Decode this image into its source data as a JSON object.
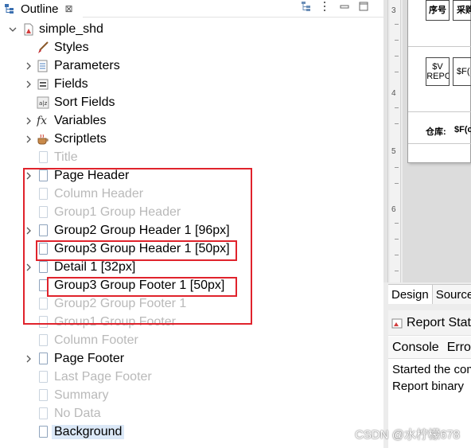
{
  "outline": {
    "tab_label": "Outline",
    "tab_close": "⊠",
    "root": {
      "label": "simple_shd",
      "twisty": "⌄"
    },
    "nodes": [
      {
        "label": "Styles",
        "twisty": "",
        "icon": "brush-icon",
        "state": "normal"
      },
      {
        "label": "Parameters",
        "twisty": "›",
        "icon": "parameters-icon",
        "state": "normal"
      },
      {
        "label": "Fields",
        "twisty": "›",
        "icon": "fields-icon",
        "state": "normal"
      },
      {
        "label": "Sort Fields",
        "twisty": "",
        "icon": "sort-fields-icon",
        "state": "normal"
      },
      {
        "label": "Variables",
        "twisty": "›",
        "icon": "fx-icon",
        "state": "normal"
      },
      {
        "label": "Scriptlets",
        "twisty": "›",
        "icon": "coffee-cup-icon",
        "state": "normal"
      },
      {
        "label": "Title",
        "twisty": "",
        "icon": "page-icon",
        "state": "disabled"
      },
      {
        "label": "Page Header",
        "twisty": "›",
        "icon": "page-icon",
        "state": "normal"
      },
      {
        "label": "Column Header",
        "twisty": "",
        "icon": "page-icon",
        "state": "disabled"
      },
      {
        "label": "Group1 Group Header",
        "twisty": "",
        "icon": "page-icon",
        "state": "disabled"
      },
      {
        "label": "Group2 Group Header 1 [96px]",
        "twisty": "›",
        "icon": "page-icon",
        "state": "normal"
      },
      {
        "label": "Group3 Group Header 1 [50px]",
        "twisty": "",
        "icon": "page-icon",
        "state": "normal"
      },
      {
        "label": "Detail 1 [32px]",
        "twisty": "›",
        "icon": "page-icon",
        "state": "normal"
      },
      {
        "label": "Group3 Group Footer 1 [50px]",
        "twisty": "",
        "icon": "page-icon",
        "state": "normal"
      },
      {
        "label": "Group2 Group Footer 1",
        "twisty": "",
        "icon": "page-icon",
        "state": "disabled"
      },
      {
        "label": "Group1 Group Footer",
        "twisty": "",
        "icon": "page-icon",
        "state": "disabled"
      },
      {
        "label": "Column Footer",
        "twisty": "",
        "icon": "page-icon",
        "state": "disabled"
      },
      {
        "label": "Page Footer",
        "twisty": "›",
        "icon": "page-icon",
        "state": "normal"
      },
      {
        "label": "Last Page Footer",
        "twisty": "",
        "icon": "page-icon",
        "state": "disabled"
      },
      {
        "label": "Summary",
        "twisty": "",
        "icon": "page-icon",
        "state": "disabled"
      },
      {
        "label": "No Data",
        "twisty": "",
        "icon": "page-icon",
        "state": "disabled"
      },
      {
        "label": "Background",
        "twisty": "",
        "icon": "page-icon",
        "state": "selected"
      }
    ],
    "toolbar_icons": [
      "tree-view-icon",
      "menu-icon",
      "minimize-icon",
      "maximize-icon"
    ]
  },
  "design": {
    "ruler_labels": [
      "3",
      "4",
      "5",
      "6"
    ],
    "cells": {
      "header_1": "序号",
      "header_2": "采购",
      "detail_1": "$V (REPO",
      "detail_2": "$F(",
      "footer_label": "仓库:",
      "footer_value": "$F(c"
    },
    "tabs": [
      "Design",
      "Source"
    ]
  },
  "console": {
    "title": "Report State",
    "subtabs": [
      "Console",
      "Errors"
    ],
    "lines": [
      "Started the compilation",
      "Report binary"
    ]
  },
  "watermark": "CSDN @水柠檬678",
  "colors": {
    "annotation_red": "#e0232c",
    "disabled_text": "#b9b9b9",
    "selection_bg": "#dbe8f7"
  }
}
